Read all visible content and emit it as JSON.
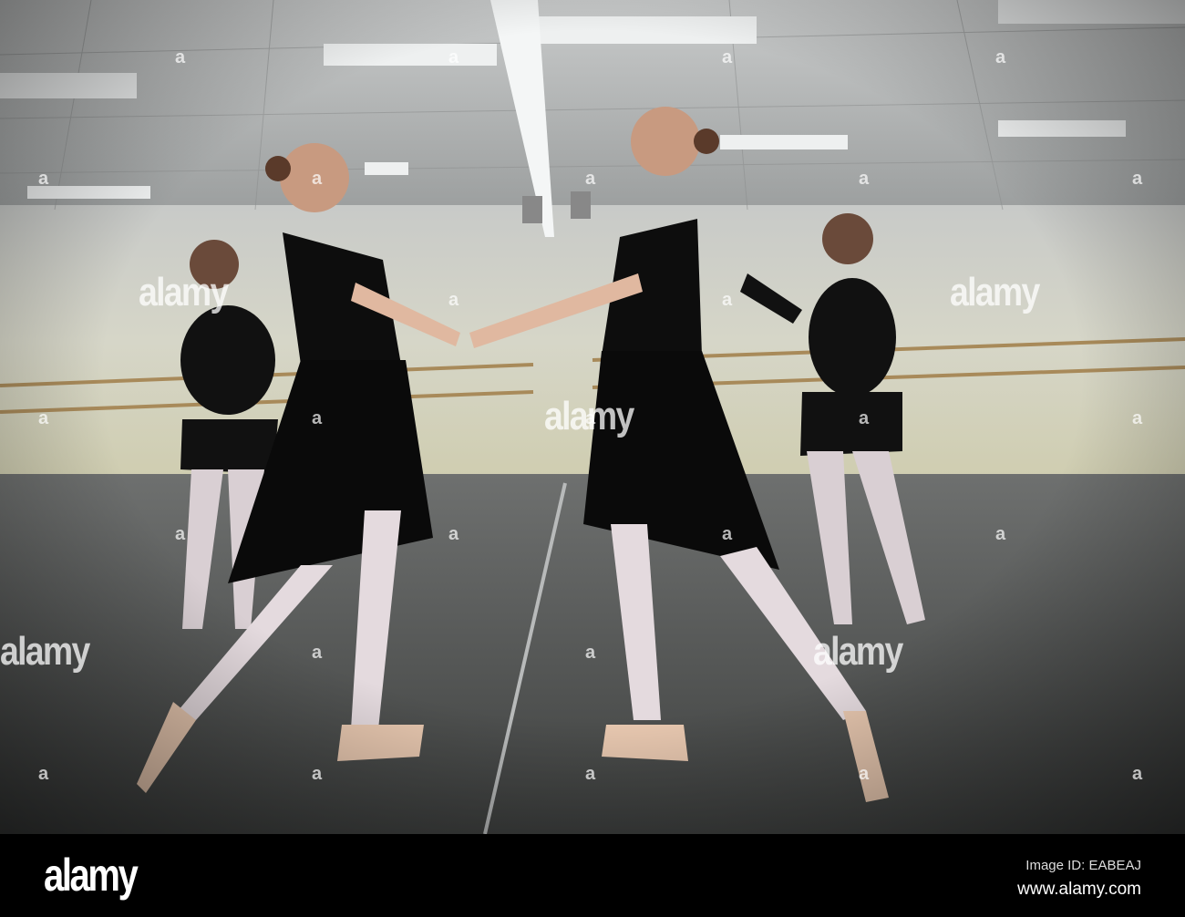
{
  "photo": {
    "description_alt": "Ballet dancers reflected in studio mirror",
    "watermark_text": "alamy",
    "watermark_mark": "a"
  },
  "footer": {
    "logo": "alamy",
    "image_id": "Image ID: EABEAJ",
    "url": "www.alamy.com"
  }
}
